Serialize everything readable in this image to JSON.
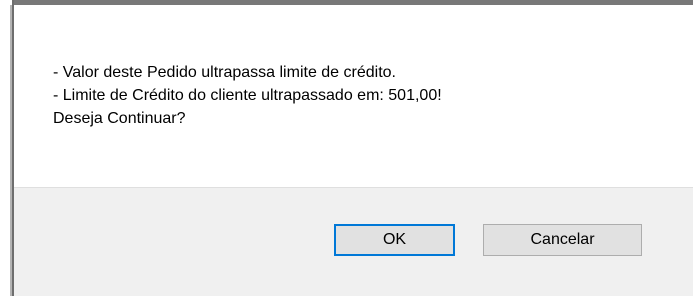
{
  "dialog": {
    "message_lines": [
      "- Valor deste Pedido ultrapassa limite de crédito.",
      "- Limite de Crédito do cliente ultrapassado em: 501,00!",
      "Deseja Continuar?"
    ],
    "ok_label": "OK",
    "cancel_label": "Cancelar"
  },
  "colors": {
    "footer_background": "#f0f0f0",
    "button_background": "#e1e1e1",
    "focus_border": "#0078d7"
  }
}
